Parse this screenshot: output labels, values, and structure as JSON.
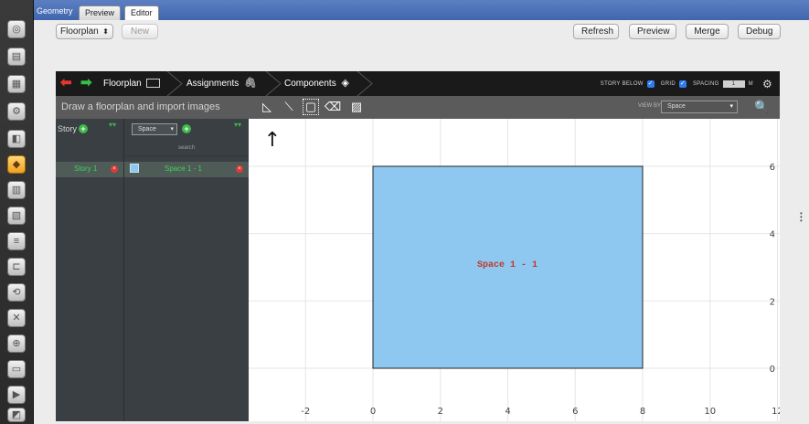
{
  "sidebar": {
    "icons": [
      "globe-icon",
      "folder-icon",
      "building-icon",
      "gear-icon",
      "cube-icon",
      "geometry-icon",
      "tower-icon",
      "book-icon",
      "layers-icon",
      "ductwork-icon",
      "loop-icon",
      "tools-icon",
      "globe-gear-icon",
      "report-icon",
      "play-icon",
      "chart-icon"
    ]
  },
  "tabs": {
    "geometry": "Geometry",
    "preview": "Preview",
    "editor": "Editor"
  },
  "topbar": {
    "mode_select": "Floorplan",
    "new_label": "New",
    "refresh": "Refresh",
    "preview": "Preview",
    "merge": "Merge",
    "debug": "Debug"
  },
  "nav": {
    "floorplan": "Floorplan",
    "assignments": "Assignments",
    "components": "Components",
    "story_below": "STORY BELOW",
    "grid": "GRID",
    "spacing": "SPACING",
    "spacing_value": "1",
    "spacing_unit": "M"
  },
  "toolbar": {
    "instruction": "Draw a floorplan and import images",
    "view_by_label": "VIEW BY",
    "view_by_value": "Space"
  },
  "stories": {
    "header": "Story",
    "items": [
      {
        "label": "Story 1"
      }
    ]
  },
  "spaces": {
    "select": "Space",
    "search": "search",
    "items": [
      {
        "label": "Space 1 - 1",
        "color": "#8ec7ef"
      }
    ]
  },
  "canvas": {
    "space_label": "Space 1 - 1",
    "x_ticks": [
      "-2",
      "0",
      "2",
      "4",
      "6",
      "8",
      "10",
      "12"
    ],
    "y_ticks": [
      "6",
      "4",
      "2",
      "0"
    ],
    "space_fill": "#8ec7ef",
    "label_color": "#c0392b"
  }
}
